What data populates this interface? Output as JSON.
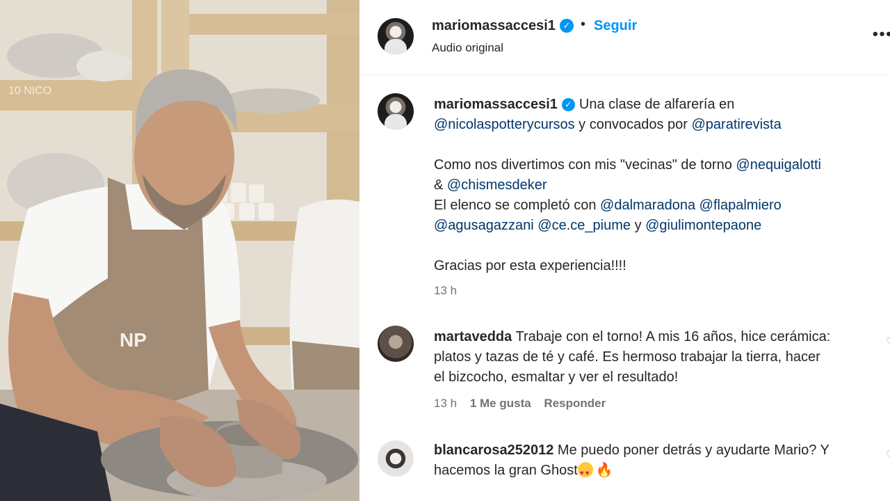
{
  "header": {
    "username": "mariomassaccesi1",
    "separator": "•",
    "follow_label": "Seguir",
    "audio_label": "Audio original",
    "more_icon": "more-options-icon"
  },
  "media": {
    "apron_logo": "NP",
    "shelf_tag": "10 NICO"
  },
  "caption": {
    "username": "mariomassaccesi1",
    "line1_text": "Una clase de alfarería en",
    "mention1": "@nicolaspotterycursos",
    "line2_mid": "y convocados por",
    "mention2": "@paratirevista",
    "line3_text": "Como nos divertimos con mis \"vecinas\" de torno",
    "mention3": "@nequigalotti",
    "amp": "&",
    "mention4": "@chismesdeker",
    "line5_text": "El elenco se completó con",
    "mention5": "@dalmaradona",
    "mention6": "@flapalmiero",
    "mention7": "@agusagazzani",
    "mention8": "@ce.ce_piume",
    "y_text": "y",
    "mention9": "@giulimontepaone",
    "thanks": "Gracias por esta experiencia!!!!",
    "time": "13 h"
  },
  "comments": [
    {
      "username": "martavedda",
      "text_l1": "Trabaje con el torno! A mis 16 años, hice cerámica:",
      "text_l2": "platos y tazas de té y café. Es hermoso trabajar la tierra, hacer",
      "text_l3": "el bizcocho, esmaltar y ver el resultado!",
      "time": "13 h",
      "likes": "1 Me gusta",
      "reply": "Responder"
    },
    {
      "username": "blancarosa252012",
      "text_l1": "Me puedo poner detrás y ayudarte Mario? Y",
      "text_l2": "hacemos la gran Ghost"
    }
  ]
}
